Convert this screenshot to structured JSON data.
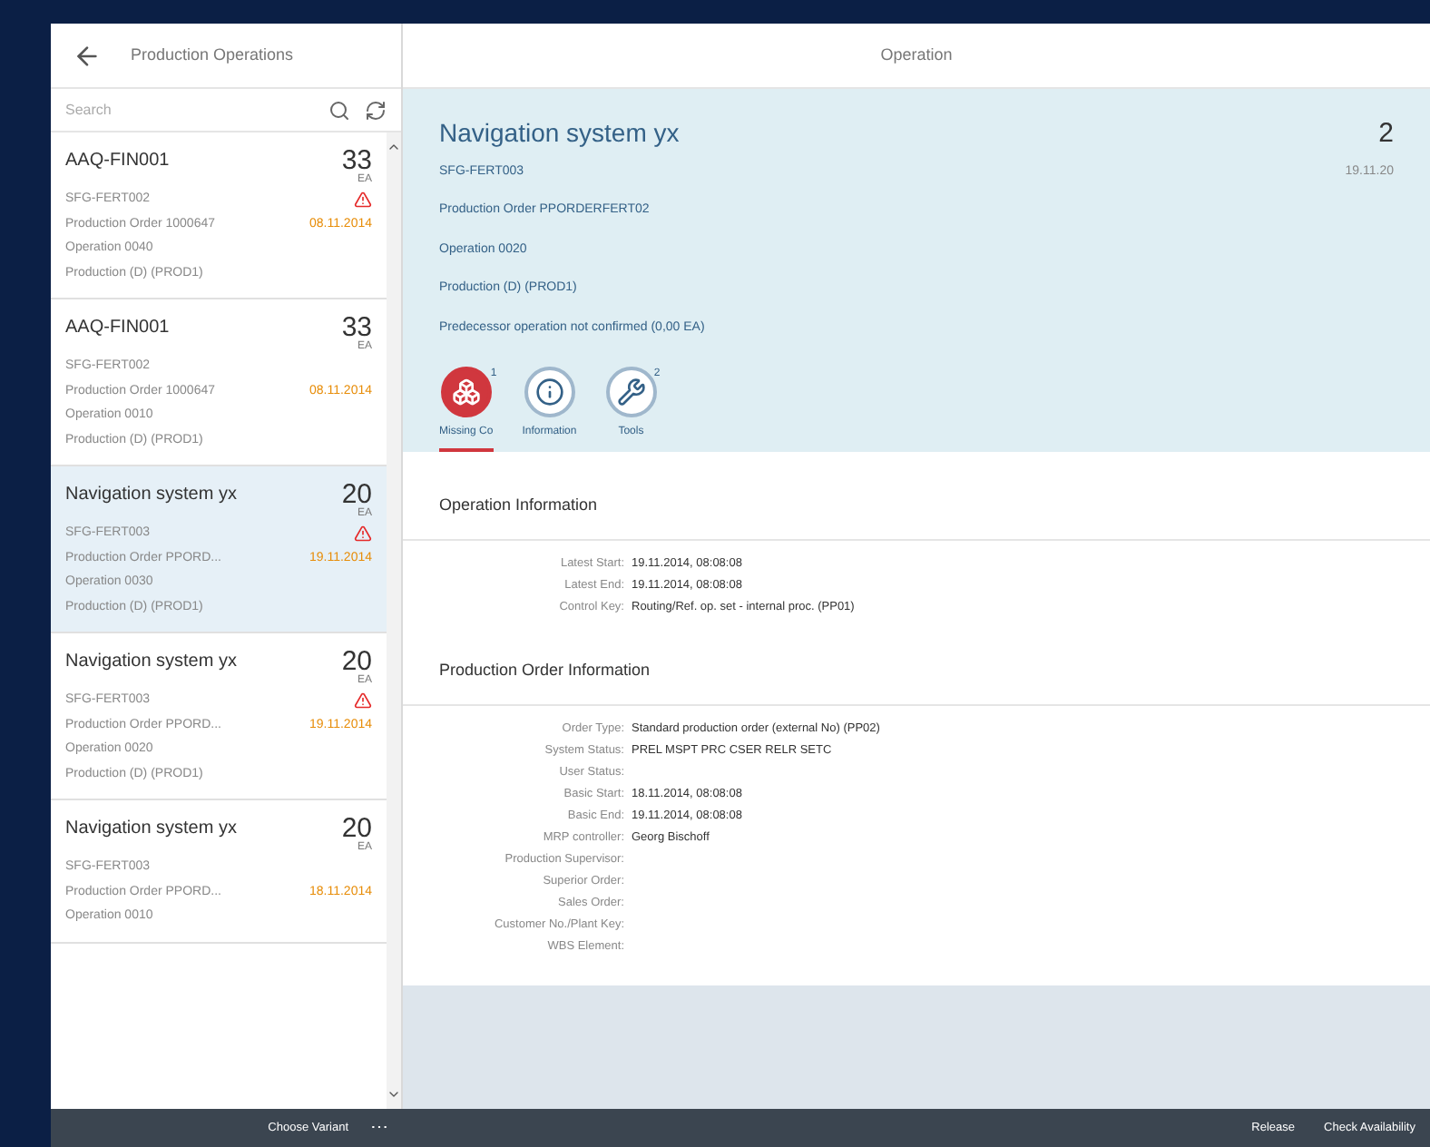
{
  "master": {
    "title": "Production Operations",
    "search": {
      "placeholder": "Search"
    },
    "items": [
      {
        "title": "AAQ-FIN001",
        "quantity": "33",
        "unit": "EA",
        "material": "SFG-FERT002",
        "order": "Production Order 1000647",
        "date": "08.11.2014",
        "operation": "Operation 0040",
        "work_center": "Production (D) (PROD1)",
        "warning": true,
        "selected": false
      },
      {
        "title": "AAQ-FIN001",
        "quantity": "33",
        "unit": "EA",
        "material": "SFG-FERT002",
        "order": "Production Order 1000647",
        "date": "08.11.2014",
        "operation": "Operation 0010",
        "work_center": "Production (D) (PROD1)",
        "warning": false,
        "selected": false
      },
      {
        "title": "Navigation system yx",
        "quantity": "20",
        "unit": "EA",
        "material": "SFG-FERT003",
        "order": "Production Order PPORD...",
        "date": "19.11.2014",
        "operation": "Operation 0030",
        "work_center": "Production (D) (PROD1)",
        "warning": true,
        "selected": true
      },
      {
        "title": "Navigation system yx",
        "quantity": "20",
        "unit": "EA",
        "material": "SFG-FERT003",
        "order": "Production Order PPORD...",
        "date": "19.11.2014",
        "operation": "Operation 0020",
        "work_center": "Production (D) (PROD1)",
        "warning": true,
        "selected": false
      },
      {
        "title": "Navigation system yx",
        "quantity": "20",
        "unit": "EA",
        "material": "SFG-FERT003",
        "order": "Production Order PPORD...",
        "date": "18.11.2014",
        "operation": "Operation 0010",
        "warning": false,
        "selected": false
      }
    ],
    "footer": {
      "variant": "Choose Variant",
      "more": "⋯"
    }
  },
  "detail": {
    "title": "Operation",
    "header": {
      "title": "Navigation system yx",
      "number": "2",
      "date": "19.11.20",
      "attributes": [
        "SFG-FERT003",
        "Production Order PPORDERFERT02",
        "Operation 0020",
        "Production (D) (PROD1)",
        "Predecessor operation not confirmed (0,00 EA)"
      ]
    },
    "tabs": [
      {
        "kind": "missing",
        "label": "Missing Co",
        "count": "1",
        "selected": true
      },
      {
        "kind": "info",
        "label": "Information",
        "selected": false
      },
      {
        "kind": "tools",
        "label": "Tools",
        "count": "2",
        "selected": false
      }
    ],
    "sections": [
      {
        "title": "Operation Information",
        "fields": [
          {
            "label": "Latest Start:",
            "value": "19.11.2014, 08:08:08"
          },
          {
            "label": "Latest End:",
            "value": "19.11.2014, 08:08:08"
          },
          {
            "label": "Control Key:",
            "value": "Routing/Ref. op. set - internal proc. (PP01)"
          }
        ]
      },
      {
        "title": "Production Order Information",
        "fields": [
          {
            "label": "Order Type:",
            "value": "Standard production order (external No) (PP02)"
          },
          {
            "label": "System Status:",
            "value": "PREL MSPT PRC CSER RELR SETC"
          },
          {
            "label": "User Status:"
          },
          {
            "label": "Basic Start:",
            "value": "18.11.2014, 08:08:08"
          },
          {
            "label": "Basic End:",
            "value": "19.11.2014, 08:08:08"
          },
          {
            "label": "MRP controller:",
            "value": "Georg Bischoff"
          },
          {
            "label": "Production Supervisor:"
          },
          {
            "label": "Superior Order:"
          },
          {
            "label": "Sales Order:"
          },
          {
            "label": "Customer No./Plant Key:"
          },
          {
            "label": "WBS Element:"
          }
        ]
      }
    ],
    "footer": {
      "actions": [
        "Release",
        "Check Availability"
      ]
    }
  }
}
